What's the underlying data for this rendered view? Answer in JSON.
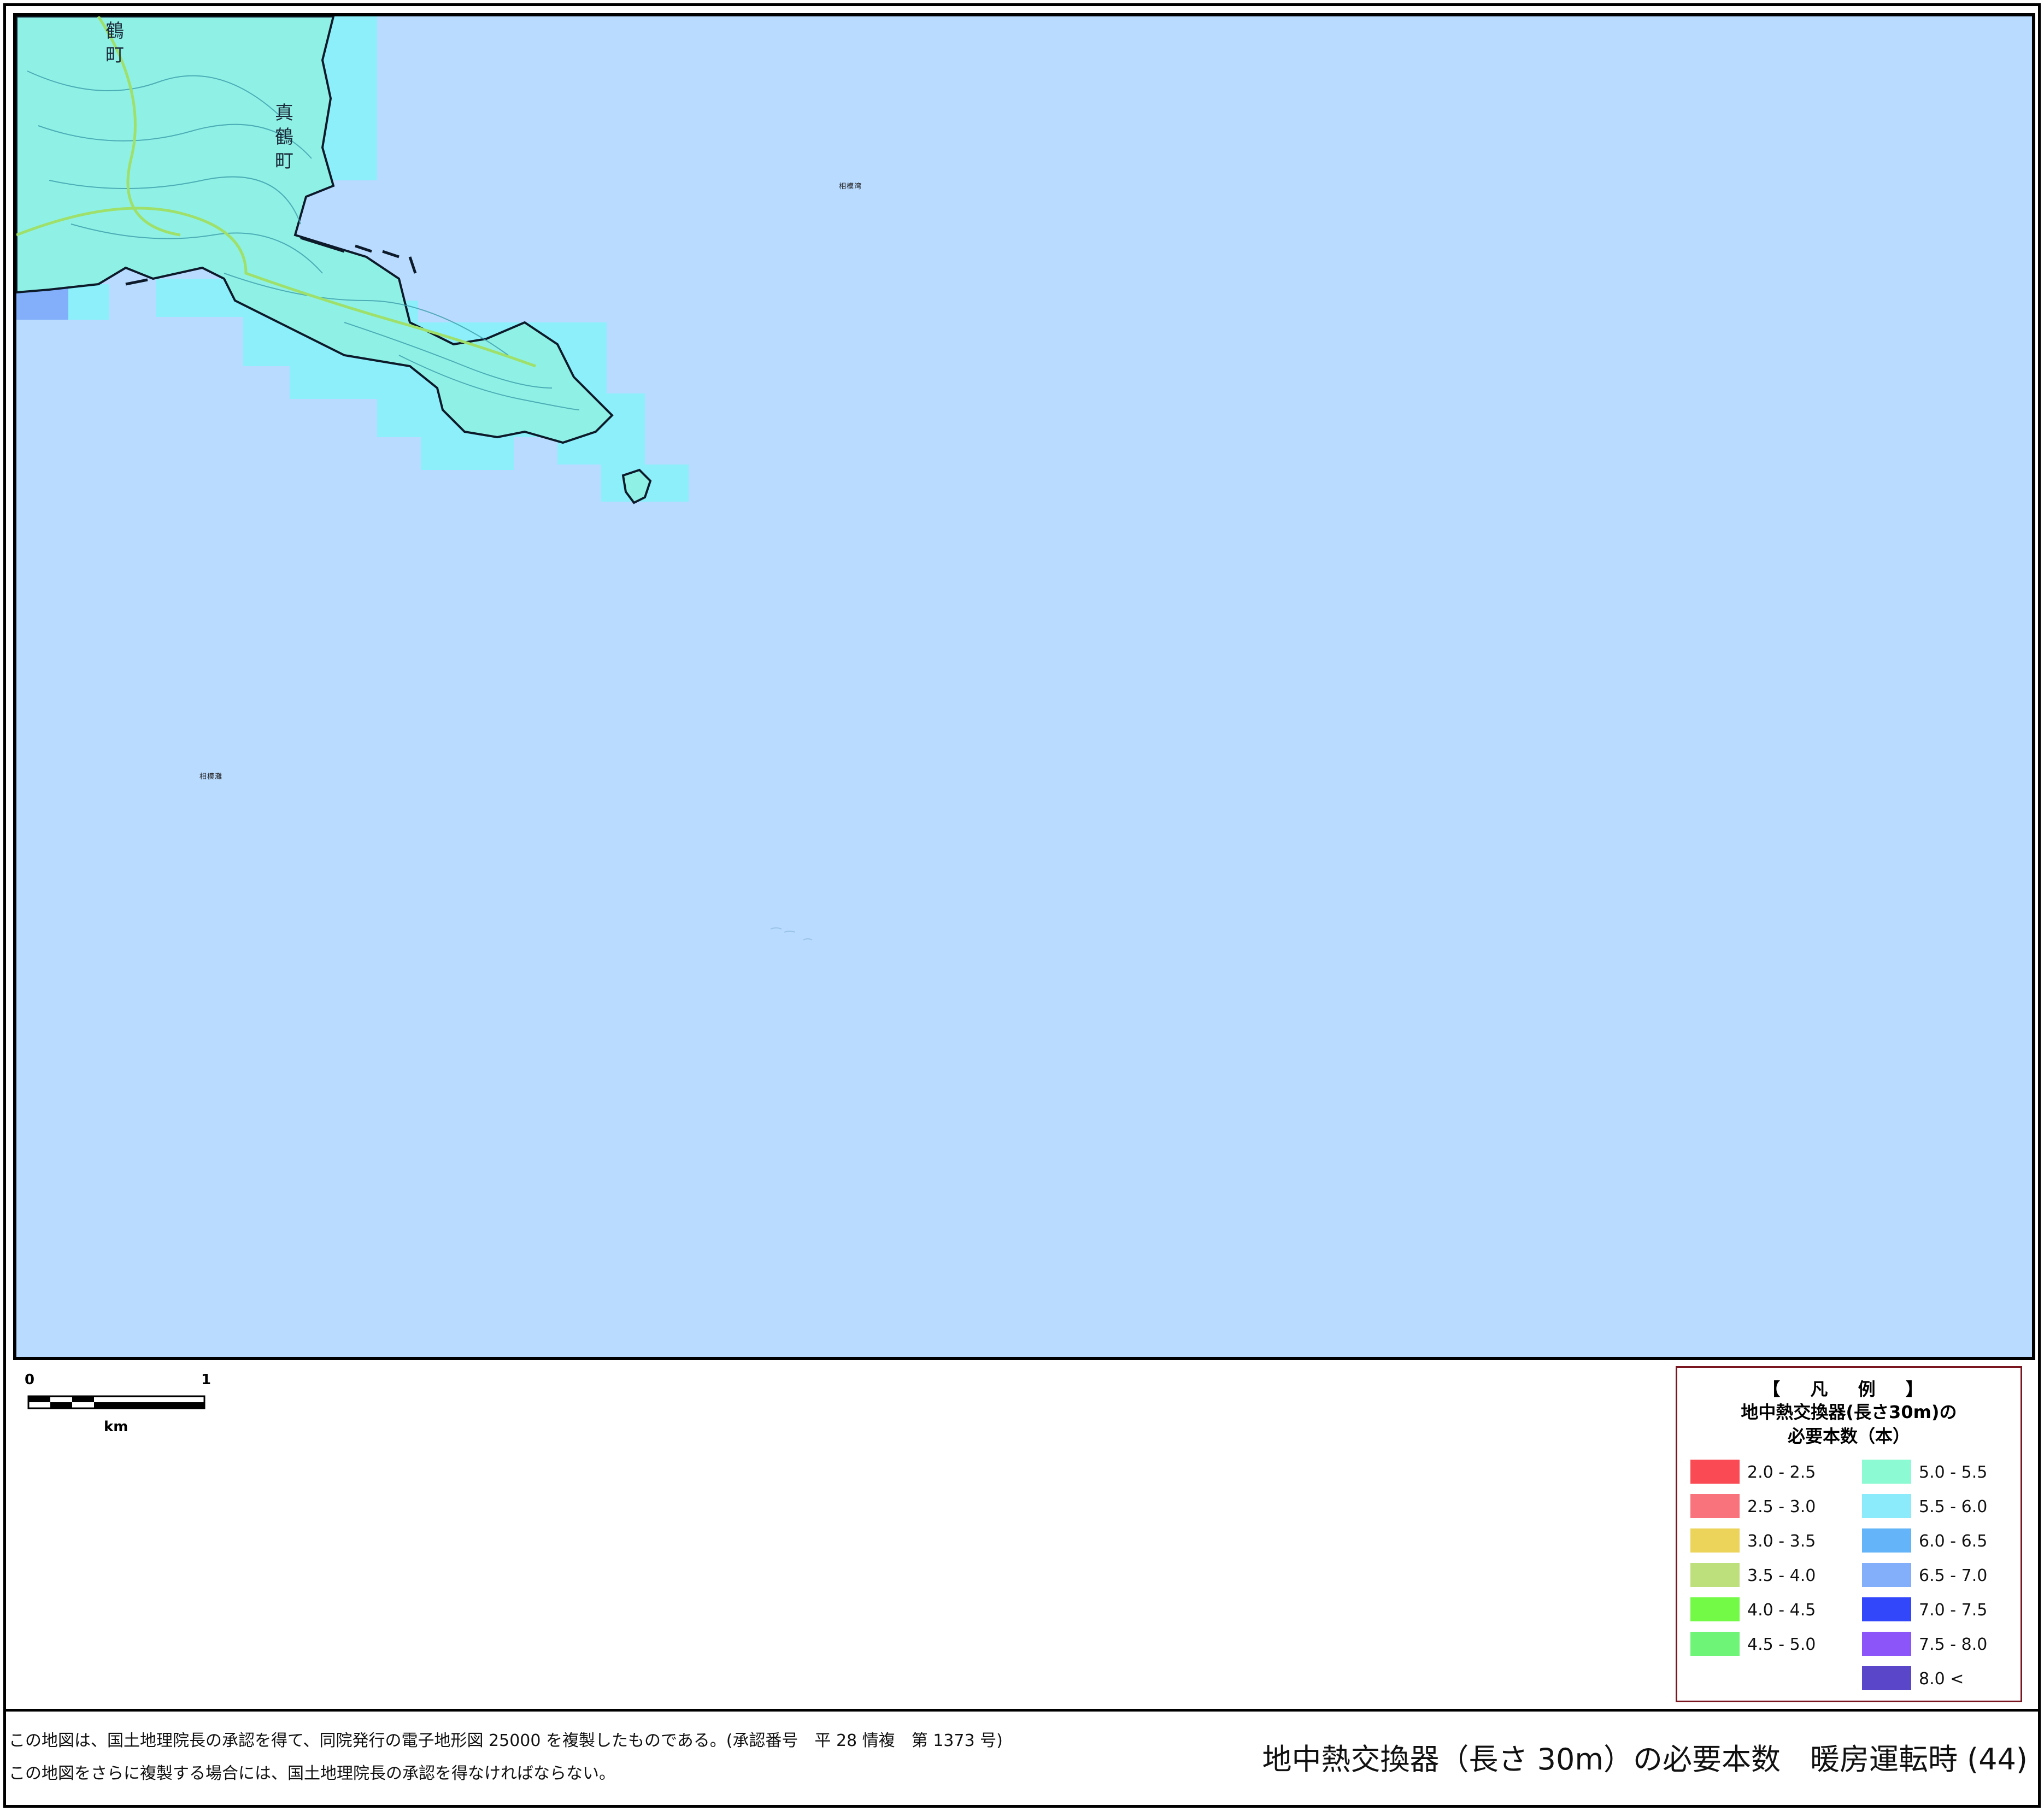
{
  "map": {
    "place_labels": [
      "相模湾",
      "相模灘"
    ],
    "town_labels": [
      "真鶴町",
      "鶴町"
    ],
    "colors": {
      "sea": "#b9dbff",
      "land": "#8ff0e6",
      "coast": "#0d1a2a"
    }
  },
  "scale_bar": {
    "start": "0",
    "end": "1",
    "unit": "km"
  },
  "legend": {
    "header": "【 凡 例 】",
    "subtitle_line1": "地中熱交換器(長さ30m)の",
    "subtitle_line2": "必要本数（本）",
    "items": [
      {
        "label": "2.0 - 2.5",
        "color": "#fa4b55"
      },
      {
        "label": "2.5 - 3.0",
        "color": "#f9737d"
      },
      {
        "label": "3.0 - 3.5",
        "color": "#ecd35a"
      },
      {
        "label": "3.5 - 4.0",
        "color": "#bde07d"
      },
      {
        "label": "4.0 - 4.5",
        "color": "#73fa46"
      },
      {
        "label": "4.5 - 5.0",
        "color": "#6ef578"
      },
      {
        "label": "5.0 - 5.5",
        "color": "#8cfad2"
      },
      {
        "label": "5.5 - 6.0",
        "color": "#8cebfa"
      },
      {
        "label": "6.0 - 6.5",
        "color": "#64b4fa"
      },
      {
        "label": "6.5 - 7.0",
        "color": "#82aefa"
      },
      {
        "label": "7.0 - 7.5",
        "color": "#3246fa"
      },
      {
        "label": "7.5 - 8.0",
        "color": "#8c55fa"
      },
      {
        "label": "8.0 <",
        "color": "#5a46c8"
      }
    ]
  },
  "footer": {
    "note_line1": "この地図は、国土地理院長の承認を得て、同院発行の電子地形図 25000 を複製したものである。(承認番号　平 28 情複　第 1373 号)",
    "note_line2": "この地図をさらに複製する場合には、国土地理院長の承認を得なければならない。",
    "title": "地中熱交換器（長さ 30m）の必要本数　暖房運転時 (44)"
  }
}
